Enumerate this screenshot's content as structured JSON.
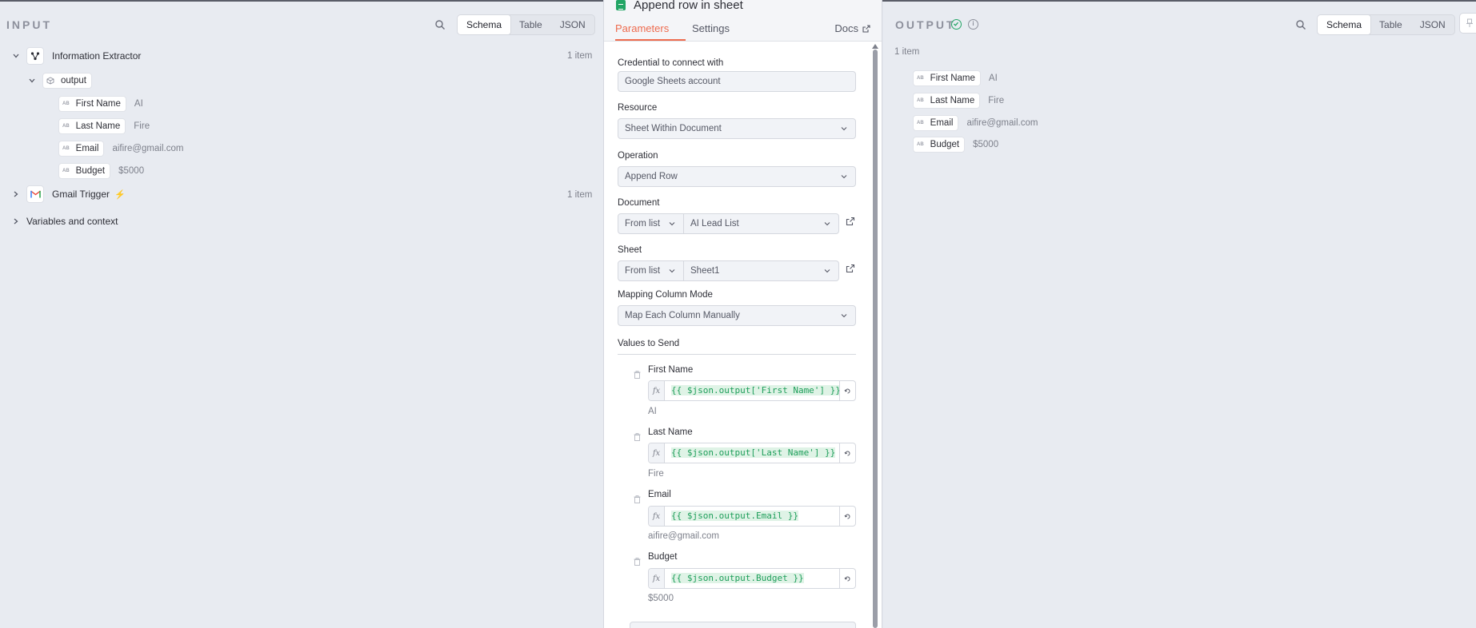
{
  "input": {
    "title": "INPUT",
    "views": [
      "Schema",
      "Table",
      "JSON"
    ],
    "active_view": "Schema",
    "nodes": [
      {
        "name": "Information Extractor",
        "count": "1 item",
        "output_label": "output",
        "fields": [
          {
            "type": "AB",
            "name": "First Name",
            "value": "AI"
          },
          {
            "type": "AB",
            "name": "Last Name",
            "value": "Fire"
          },
          {
            "type": "AB",
            "name": "Email",
            "value": "aifire@gmail.com"
          },
          {
            "type": "AB",
            "name": "Budget",
            "value": "$5000"
          }
        ]
      },
      {
        "name": "Gmail Trigger",
        "count": "1 item"
      }
    ],
    "variables_label": "Variables and context"
  },
  "editor": {
    "title": "Append row in sheet",
    "tabs": [
      "Parameters",
      "Settings"
    ],
    "active_tab": "Parameters",
    "docs_label": "Docs",
    "credential_label": "Credential to connect with",
    "credential_value": "Google Sheets account",
    "resource_label": "Resource",
    "resource_value": "Sheet Within Document",
    "operation_label": "Operation",
    "operation_value": "Append Row",
    "document_label": "Document",
    "document_mode": "From list",
    "document_value": "AI Lead List",
    "sheet_label": "Sheet",
    "sheet_mode": "From list",
    "sheet_value": "Sheet1",
    "mapping_label": "Mapping Column Mode",
    "mapping_value": "Map Each Column Manually",
    "values_label": "Values to Send",
    "values": [
      {
        "name": "First Name",
        "expression": "{{ $json.output['First Name'] }}",
        "preview": "AI"
      },
      {
        "name": "Last Name",
        "expression": "{{ $json.output['Last Name'] }}",
        "preview": "Fire"
      },
      {
        "name": "Email",
        "expression": "{{ $json.output.Email }}",
        "preview": "aifire@gmail.com"
      },
      {
        "name": "Budget",
        "expression": "{{ $json.output.Budget }}",
        "preview": "$5000"
      }
    ]
  },
  "output": {
    "title": "OUTPUT",
    "views": [
      "Schema",
      "Table",
      "JSON"
    ],
    "active_view": "Schema",
    "count": "1 item",
    "fields": [
      {
        "type": "AB",
        "name": "First Name",
        "value": "AI"
      },
      {
        "type": "AB",
        "name": "Last Name",
        "value": "Fire"
      },
      {
        "type": "AB",
        "name": "Email",
        "value": "aifire@gmail.com"
      },
      {
        "type": "AB",
        "name": "Budget",
        "value": "$5000"
      }
    ]
  },
  "colors": {
    "accent": "#ee6b4e",
    "success": "#22a565",
    "expression_text": "#1e9e5a"
  }
}
